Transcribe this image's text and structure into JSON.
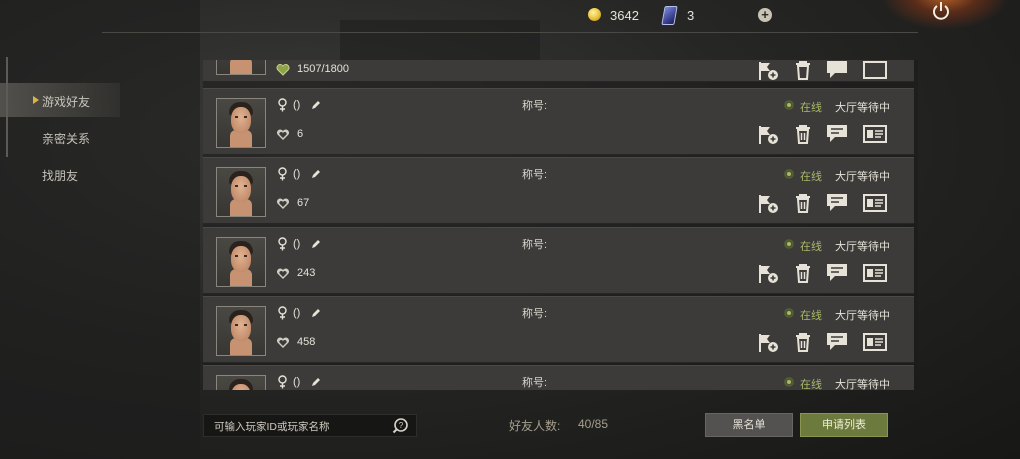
{
  "topbar": {
    "coins": "3642",
    "tickets": "3"
  },
  "sidebar": {
    "items": [
      {
        "label": "游戏好友",
        "active": true
      },
      {
        "label": "亲密关系",
        "active": false
      },
      {
        "label": "找朋友",
        "active": false
      }
    ]
  },
  "partial_top": {
    "text": "1507/1800"
  },
  "friends": [
    {
      "name": "()",
      "intimacy": "6",
      "title_label": "称号:",
      "online": "在线",
      "status": "大厅等待中"
    },
    {
      "name": "()",
      "intimacy": "67",
      "title_label": "称号:",
      "online": "在线",
      "status": "大厅等待中"
    },
    {
      "name": "()",
      "intimacy": "243",
      "title_label": "称号:",
      "online": "在线",
      "status": "大厅等待中"
    },
    {
      "name": "()",
      "intimacy": "458",
      "title_label": "称号:",
      "online": "在线",
      "status": "大厅等待中"
    },
    {
      "name": "()",
      "intimacy": "",
      "title_label": "称号:",
      "online": "在线",
      "status": "大厅等待中"
    }
  ],
  "bottom": {
    "search_placeholder": "可输入玩家ID或玩家名称",
    "friend_count_label": "好友人数:",
    "friend_count_value": "40/85",
    "blacklist_button": "黑名单",
    "apply_list_button": "申请列表"
  },
  "colors": {
    "online_green": "#a8b86a",
    "accent_gold": "#d8b646",
    "apply_button": "#6d7a3d"
  }
}
